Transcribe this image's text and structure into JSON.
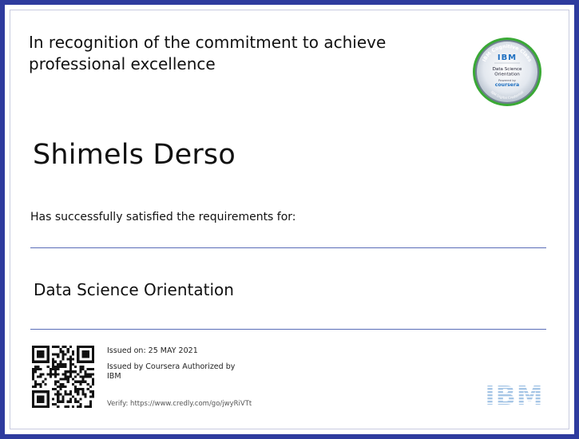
{
  "certificate": {
    "recognition_text": "In recognition of the commitment to achieve professional excellence",
    "recipient_name": "Shimels Derso",
    "satisfied_text": "Has successfully satisfied the requirements for:",
    "course_title": "Data Science Orientation",
    "issued_on": "Issued on: 25 MAY 2021",
    "issued_by": "Issued by Coursera Authorized by IBM",
    "verify": "Verify: https://www.credly.com/go/jwyRiVTt"
  },
  "badge": {
    "top_text": "IBM Cognitive Class",
    "logo_text": "IBM",
    "title_line1": "Data Science",
    "title_line2": "Orientation",
    "powered_by": "Powered by",
    "brand": "coursera",
    "bottom_text": "IBM Digital Credential"
  },
  "logo": {
    "text": "IBM"
  },
  "colors": {
    "border": "#2e3b9e",
    "ibm_blue": "#1f70c1",
    "badge_ring": "#3aa935",
    "rule": "#5a6db8"
  }
}
